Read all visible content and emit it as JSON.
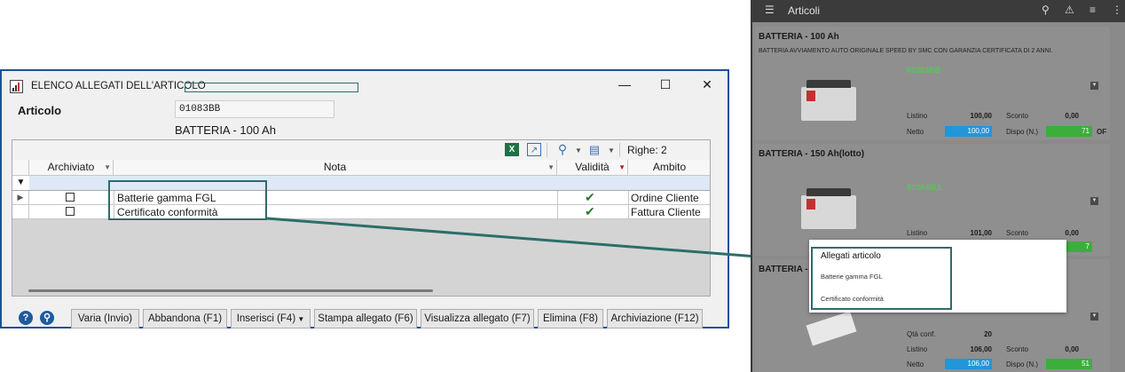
{
  "dialog": {
    "title": "ELENCO ALLEGATI DELL'ARTICOLO",
    "articolo_label": "Articolo",
    "articolo_code": "01083BB",
    "articolo_desc": "BATTERIA - 100 Ah",
    "toolbar": {
      "righe": "Righe: 2"
    },
    "columns": {
      "archiviato": "Archiviato",
      "nota": "Nota",
      "validita": "Validità",
      "ambito": "Ambito"
    },
    "rows": [
      {
        "nota": "Batterie gamma FGL",
        "ambito": "Ordine Cliente"
      },
      {
        "nota": "Certificato conformità",
        "ambito": "Fattura Cliente"
      }
    ],
    "buttons": {
      "varia": "Varia (Invio)",
      "abbandona": "Abbandona (F1)",
      "inserisci": "Inserisci (F4)",
      "stampa": "Stampa allegato (F6)",
      "visualizza": "Visualizza allegato (F7)",
      "elimina": "Elimina (F8)",
      "archiviazione": "Archiviazione (F12)"
    }
  },
  "mobile": {
    "title": "Articoli",
    "cards": [
      {
        "name": "BATTERIA - 100 Ah",
        "description": "BATTERIA AVVIAMENTO AUTO ORIGINALE SPEED BY SMC CON GARANZIA CERTIFICATA DI 2 ANNI.",
        "code": "01083BB",
        "listino_label": "Listino",
        "listino": "100,00",
        "sconto_label": "Sconto",
        "sconto": "0,00",
        "netto_label": "Netto",
        "netto": "100,00",
        "dispo_label": "Dispo (N.)",
        "dispo": "71",
        "unit": "OF"
      },
      {
        "name": "BATTERIA - 150 Ah(lotto)",
        "code": "010840LL",
        "listino_label": "Listino",
        "listino": "101,00",
        "sconto_label": "Sconto",
        "sconto": "0,00",
        "dispo": "7"
      },
      {
        "name": "BATTERIA -",
        "qta_label": "Qtà conf.",
        "qta": "20",
        "listino_label": "Listino",
        "listino": "106,00",
        "sconto_label": "Sconto",
        "sconto": "0,00",
        "netto_label": "Netto",
        "netto": "106,00",
        "dispo_label": "Dispo (N.)",
        "dispo": "51"
      }
    ],
    "popup": {
      "title": "Allegati articolo",
      "items": [
        "Batterie gamma FGL",
        "Certificato conformità"
      ]
    }
  },
  "colors": {
    "highlight": "#2b6e69",
    "window_border": "#1f4e9c",
    "pill_blue": "#2196d8",
    "pill_green": "#3cae3c"
  }
}
